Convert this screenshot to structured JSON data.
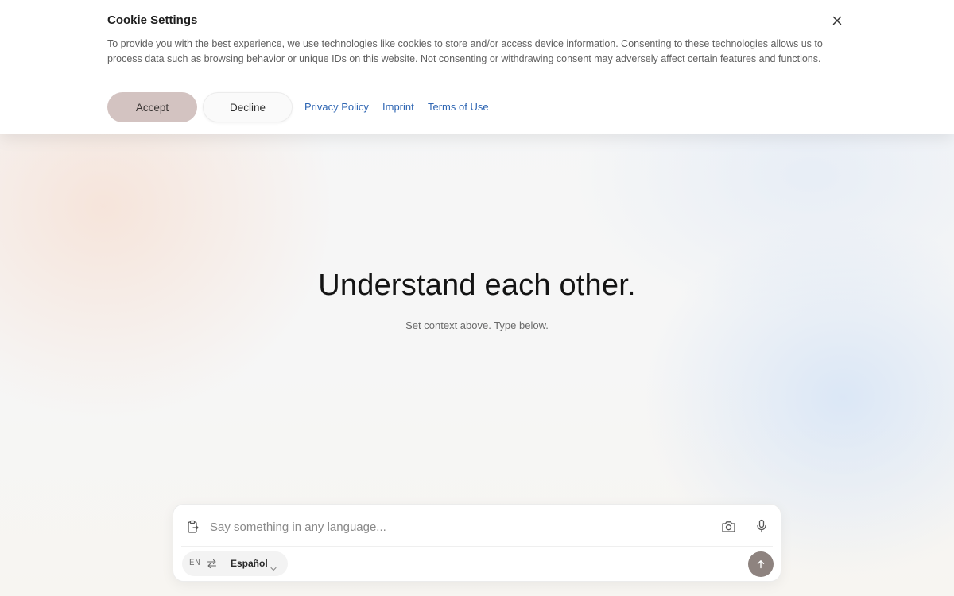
{
  "cookie_banner": {
    "title": "Cookie Settings",
    "text": "To provide you with the best experience, we use technologies like cookies to store and/or access device information. Consenting to these technologies allows us to process data such as browsing behavior or unique IDs on this website. Not consenting or withdrawing consent may adversely affect certain features and functions.",
    "accept_label": "Accept",
    "decline_label": "Decline",
    "links": {
      "privacy": "Privacy Policy",
      "imprint": "Imprint",
      "terms": "Terms of Use"
    },
    "close_icon": "close-icon"
  },
  "hero": {
    "title": "Understand each other.",
    "subtitle": "Set context above. Type below."
  },
  "composer": {
    "placeholder": "Say something in any language...",
    "source_lang": "EN",
    "target_lang": "Español",
    "icons": [
      "paste-icon",
      "camera-icon",
      "microphone-icon",
      "swap-icon",
      "chevron-down-icon",
      "send-arrow-icon"
    ]
  },
  "colors": {
    "accept_bg": "#d3c3c1",
    "link": "#2f66b3",
    "send_bg": "#8e837f"
  }
}
